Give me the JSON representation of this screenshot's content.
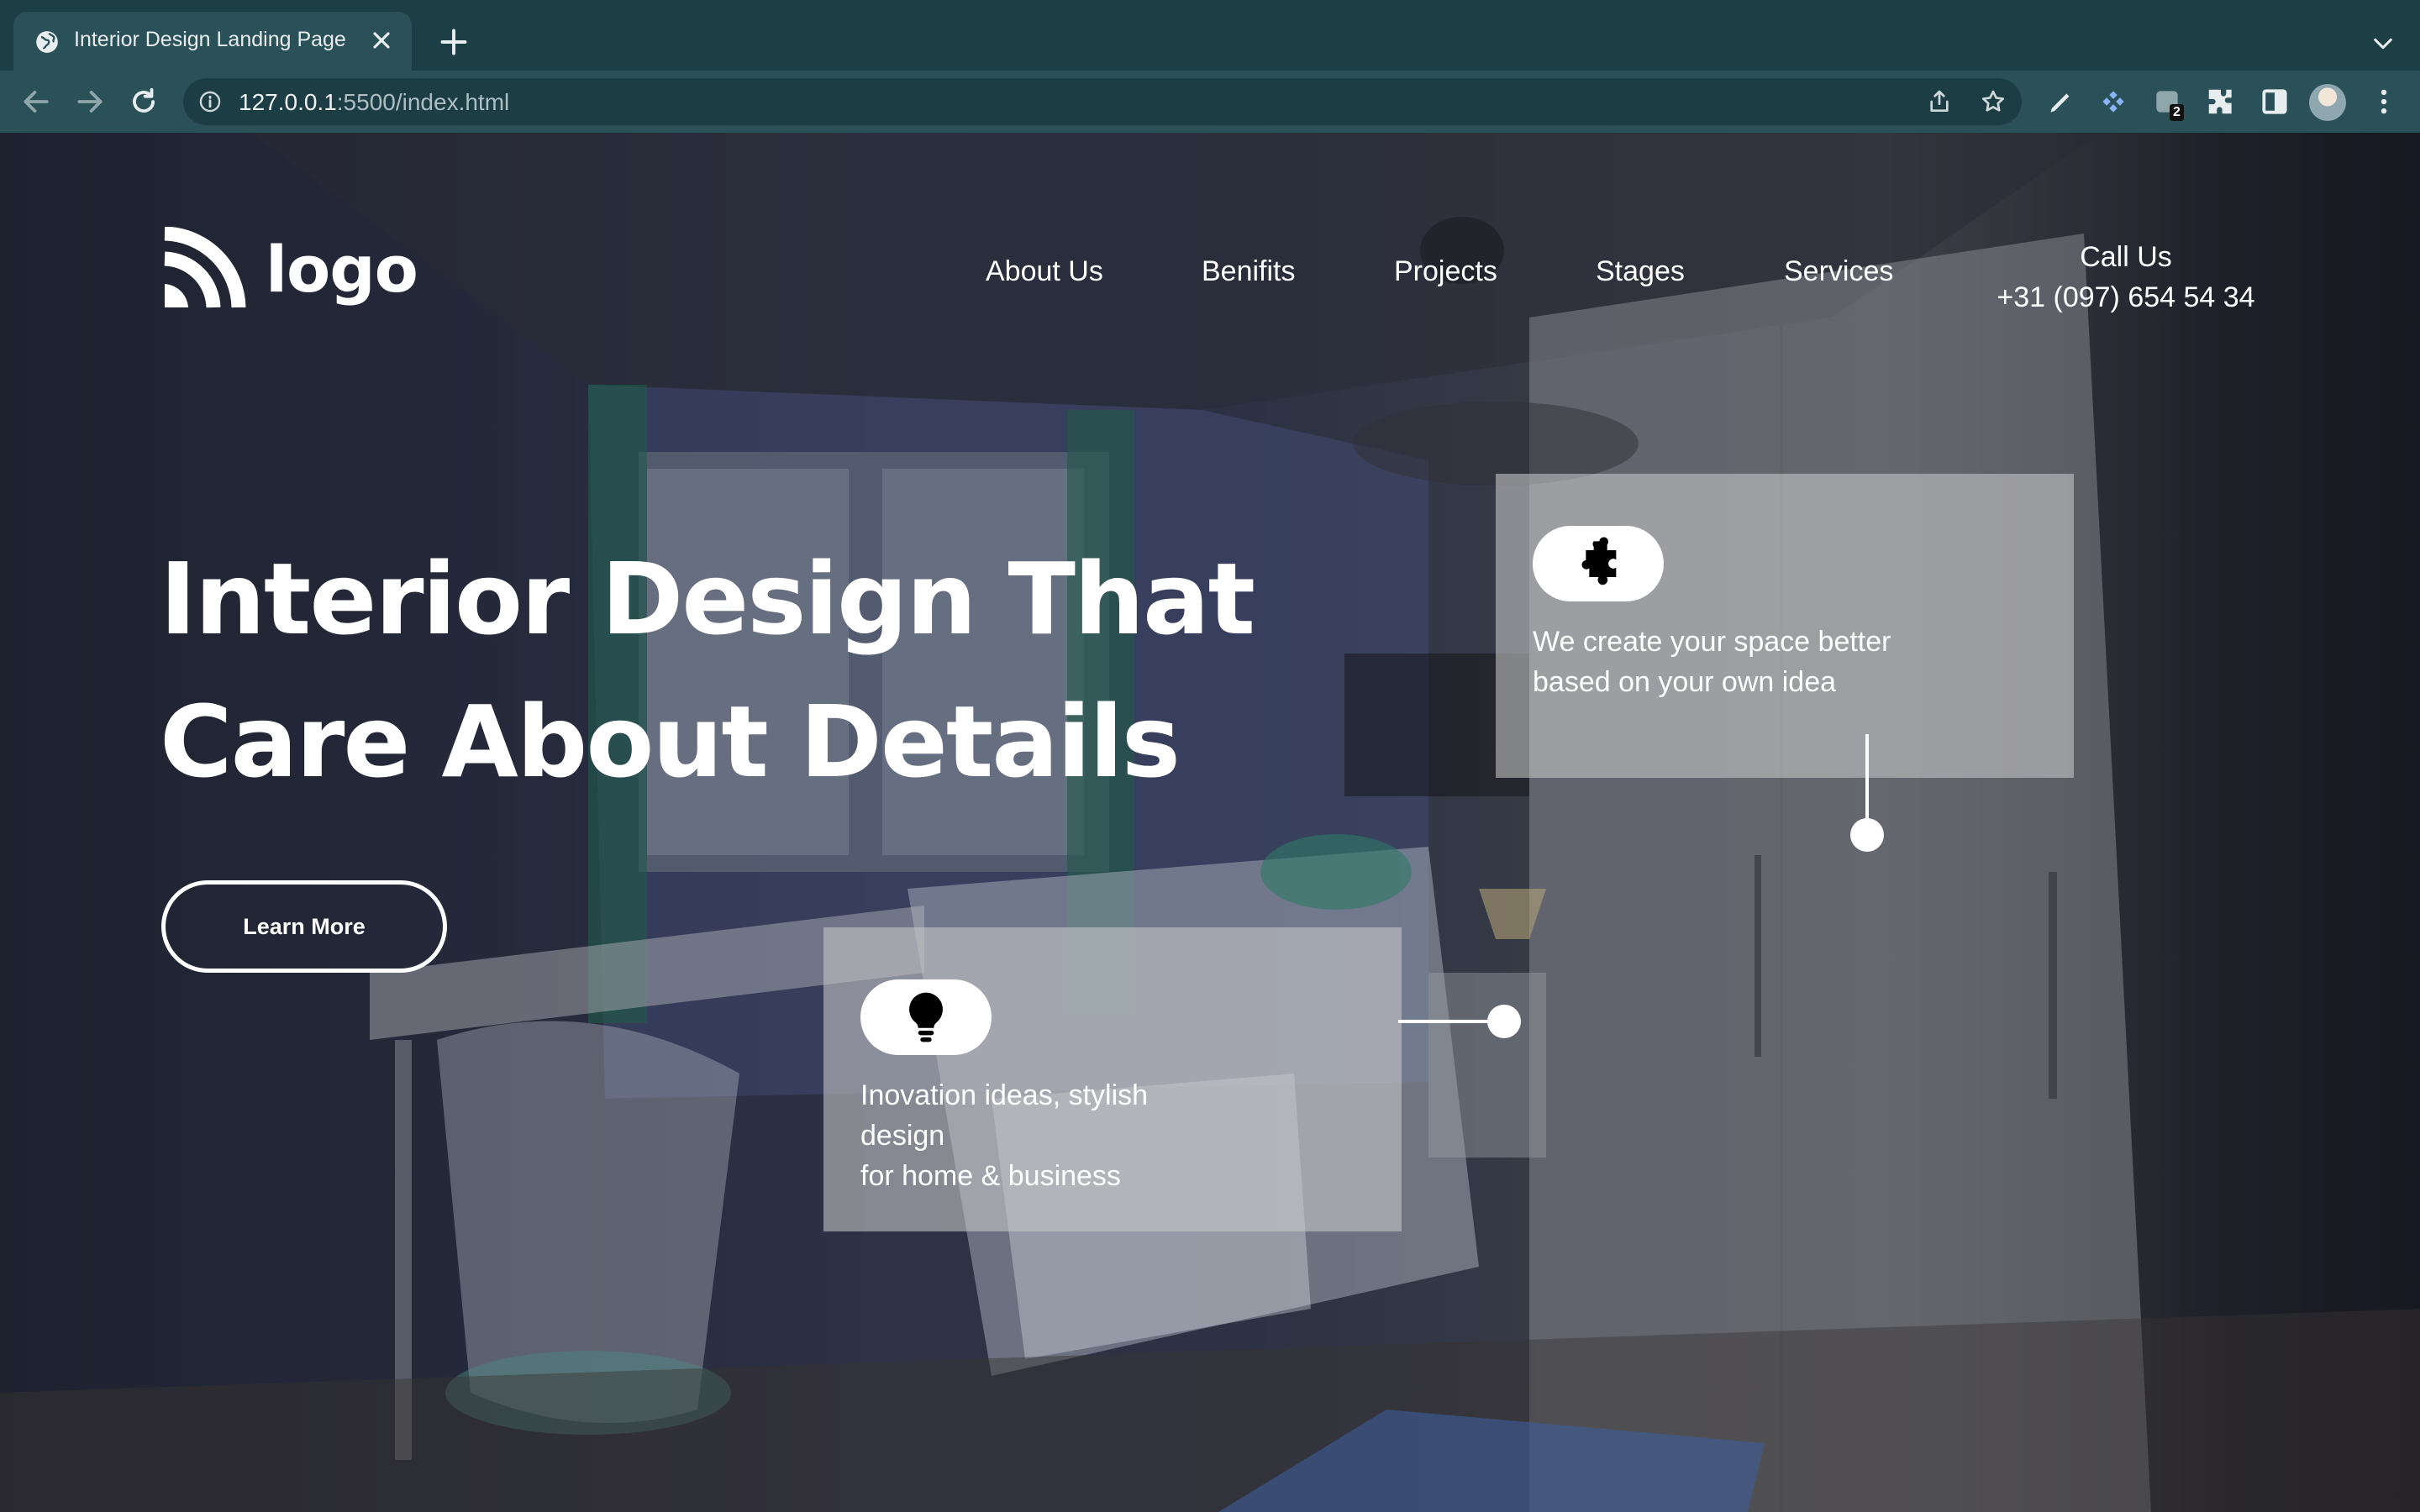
{
  "browser": {
    "tab_title": "Interior Design Landing Page",
    "url_host": "127.0.0.1",
    "url_rest": ":5500/index.html",
    "extension_badge": "2"
  },
  "site": {
    "logo_text": "logo",
    "nav": [
      "About Us",
      "Benifits",
      "Projects",
      "Stages",
      "Services"
    ],
    "call_label": "Call Us",
    "call_number": "+31 (097) 654 54 34",
    "hero_line1": "Interior Design That",
    "hero_line2": "Care About Details",
    "cta_label": "Learn More",
    "card_top": {
      "icon": "puzzle-icon",
      "line1": "We create your space better",
      "line2": "based on your own idea"
    },
    "card_bottom": {
      "icon": "lightbulb-icon",
      "line1": "Inovation ideas, stylish",
      "line2": "design",
      "line3": "for home & business"
    }
  }
}
